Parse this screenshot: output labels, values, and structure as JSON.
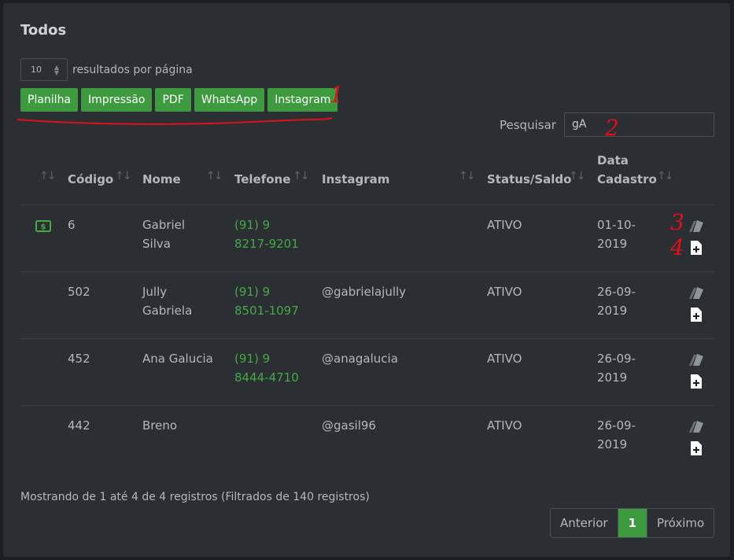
{
  "title": "Todos",
  "page_length": {
    "value": "10",
    "label": "resultados por página"
  },
  "export_buttons": [
    "Planilha",
    "Impressão",
    "PDF",
    "WhatsApp",
    "Instagram"
  ],
  "search": {
    "label": "Pesquisar",
    "value": "gA"
  },
  "annotations": [
    "1",
    "2",
    "3",
    "4"
  ],
  "columns": [
    "Código",
    "Nome",
    "Telefone",
    "Instagram",
    "Status/Saldo",
    "Data\nCadastro"
  ],
  "rows": [
    {
      "codigo": "6",
      "nome": "Gabriel\nSilva",
      "telefone": "(91) 9\n8217-9201",
      "instagram": "",
      "status": "ATIVO",
      "data": "01-10-\n2019",
      "money_icon": true
    },
    {
      "codigo": "502",
      "nome": "Jully\nGabriela",
      "telefone": "(91) 9\n8501-1097",
      "instagram": "@gabrielajully",
      "status": "ATIVO",
      "data": "26-09-\n2019",
      "money_icon": false
    },
    {
      "codigo": "452",
      "nome": "Ana Galucia",
      "telefone": "(91) 9\n8444-4710",
      "instagram": "@anagalucia",
      "status": "ATIVO",
      "data": "26-09-\n2019",
      "money_icon": false
    },
    {
      "codigo": "442",
      "nome": "Breno",
      "telefone": "",
      "instagram": "@gasil96",
      "status": "ATIVO",
      "data": "26-09-\n2019",
      "money_icon": false
    }
  ],
  "info": "Mostrando de 1 até 4 de 4 registros (Filtrados de 140 registros)",
  "pagination": {
    "prev": "Anterior",
    "current": "1",
    "next": "Próximo"
  },
  "colors": {
    "accent": "#3d9a3f",
    "annotation": "#e0101a",
    "background": "#2b2e33"
  }
}
